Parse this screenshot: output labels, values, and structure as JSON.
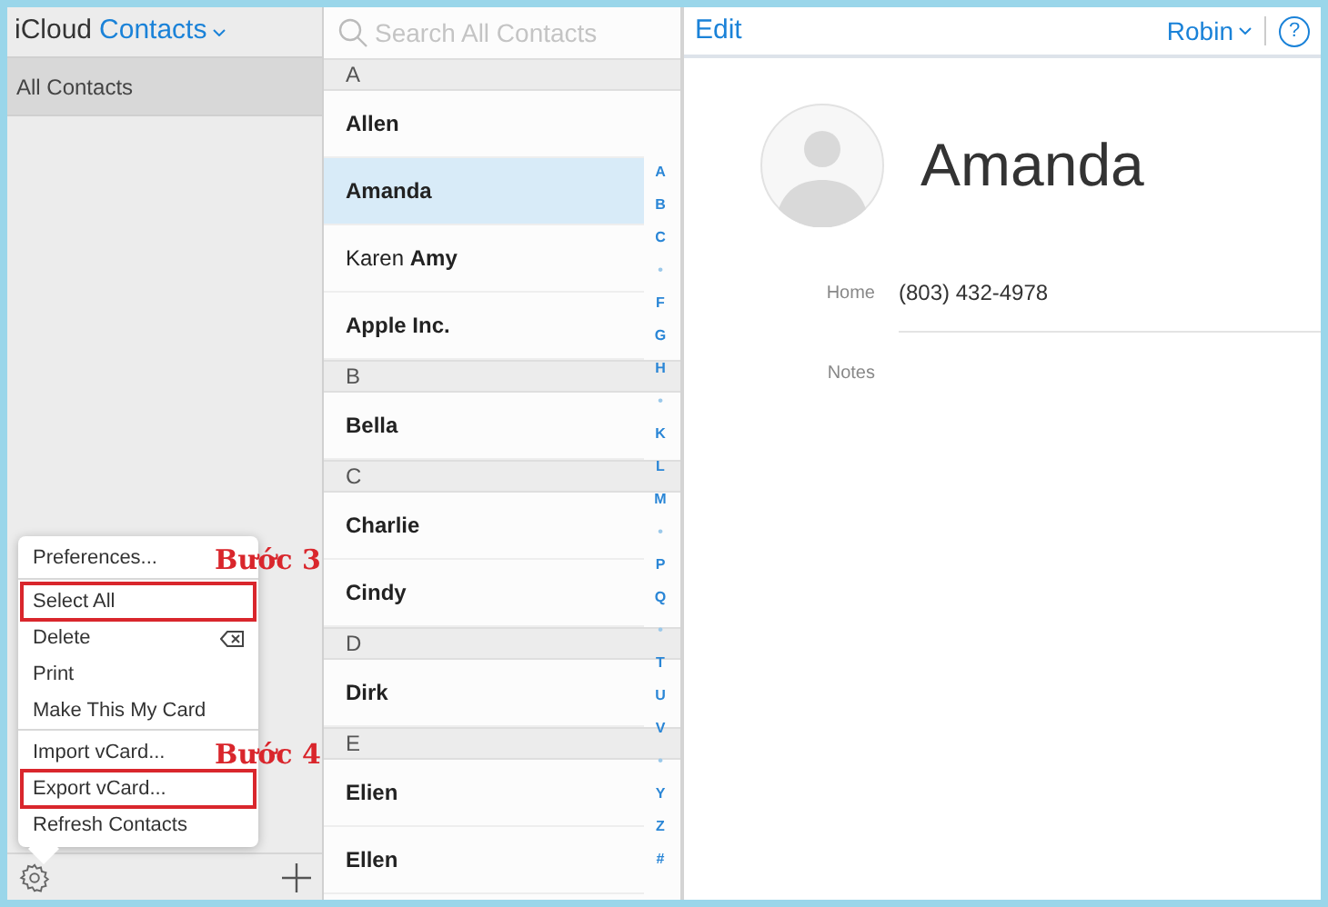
{
  "header": {
    "brand": "iCloud",
    "app": "Contacts",
    "search": {
      "placeholder": "Search All Contacts"
    }
  },
  "sidebar": {
    "items": [
      {
        "label": "All Contacts",
        "selected": true
      }
    ]
  },
  "menu": {
    "groups": [
      [
        {
          "label": "Preferences...",
          "highlighted": false
        }
      ],
      [
        {
          "label": "Select All",
          "highlighted": true
        },
        {
          "label": "Delete",
          "highlighted": false,
          "kind": "delete"
        },
        {
          "label": "Print",
          "highlighted": false
        },
        {
          "label": "Make This My Card",
          "highlighted": false
        }
      ],
      [
        {
          "label": "Import vCard...",
          "highlighted": false
        },
        {
          "label": "Export vCard...",
          "highlighted": true
        },
        {
          "label": "Refresh Contacts",
          "highlighted": false
        }
      ]
    ]
  },
  "annotations": [
    {
      "text": "Bước 3"
    },
    {
      "text": "Bước 4"
    }
  ],
  "contacts": [
    {
      "kind": "header",
      "label": "A"
    },
    {
      "kind": "contact",
      "name": "Allen",
      "selected": false
    },
    {
      "kind": "contact",
      "name": "Amanda",
      "selected": true
    },
    {
      "kind": "contact",
      "name": "Karen **Amy**",
      "selected": false
    },
    {
      "kind": "contact",
      "name": "Apple Inc.",
      "selected": false
    },
    {
      "kind": "header",
      "label": "B"
    },
    {
      "kind": "contact",
      "name": "Bella",
      "selected": false
    },
    {
      "kind": "header",
      "label": "C"
    },
    {
      "kind": "contact",
      "name": "Charlie",
      "selected": false
    },
    {
      "kind": "contact",
      "name": "Cindy",
      "selected": false
    },
    {
      "kind": "header",
      "label": "D"
    },
    {
      "kind": "contact",
      "name": "Dirk",
      "selected": false
    },
    {
      "kind": "header",
      "label": "E"
    },
    {
      "kind": "contact",
      "name": "Elien",
      "selected": false
    },
    {
      "kind": "contact",
      "name": "Ellen",
      "selected": false
    }
  ],
  "index": [
    "A",
    "B",
    "C",
    "•",
    "F",
    "G",
    "H",
    "•",
    "K",
    "L",
    "M",
    "•",
    "P",
    "Q",
    "•",
    "T",
    "U",
    "V",
    "•",
    "Y",
    "Z",
    "#"
  ],
  "detail": {
    "edit": "Edit",
    "user": "Robin",
    "help": "?",
    "name": "Amanda",
    "fields": [
      {
        "label": "Home",
        "value": "(803) 432-4978"
      },
      {
        "label": "Notes"
      }
    ]
  }
}
